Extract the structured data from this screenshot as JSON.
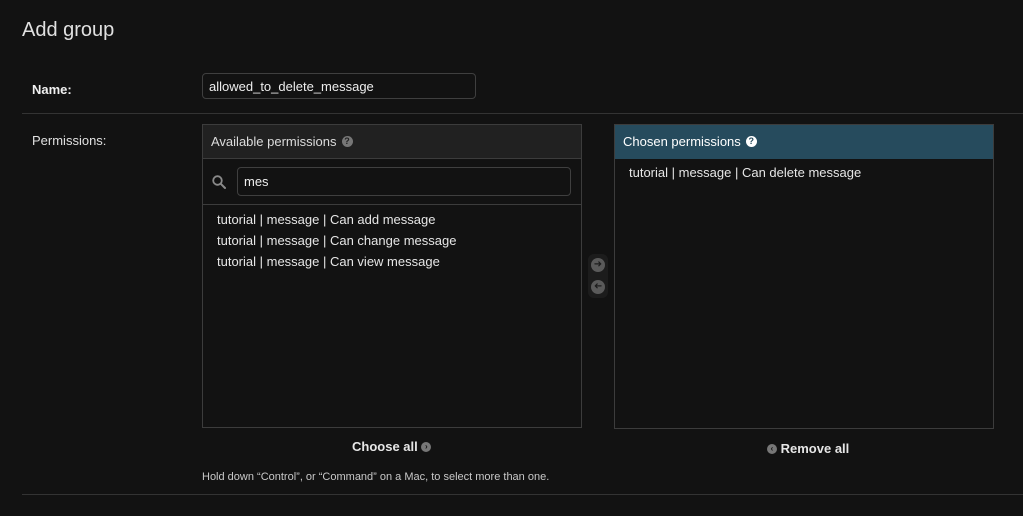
{
  "page": {
    "title": "Add group"
  },
  "form": {
    "name_label": "Name:",
    "name_value": "allowed_to_delete_message",
    "permissions_label": "Permissions:",
    "help_text": "Hold down “Control”, or “Command” on a Mac, to select more than one."
  },
  "available": {
    "header": "Available permissions",
    "help_glyph": "?",
    "filter_value": "mes",
    "items": [
      "tutorial | message | Can add message",
      "tutorial | message | Can change message",
      "tutorial | message | Can view message"
    ],
    "choose_all_label": "Choose all"
  },
  "chosen": {
    "header": "Chosen permissions",
    "help_glyph": "?",
    "items": [
      "tutorial | message | Can delete message"
    ],
    "remove_all_label": "Remove all"
  },
  "icons": {
    "search": "search-icon",
    "add_arrow": "arrow-right-icon",
    "remove_arrow": "arrow-left-icon"
  },
  "colors": {
    "background": "#121212",
    "chosen_header": "#264b5d",
    "available_header": "#212121"
  }
}
